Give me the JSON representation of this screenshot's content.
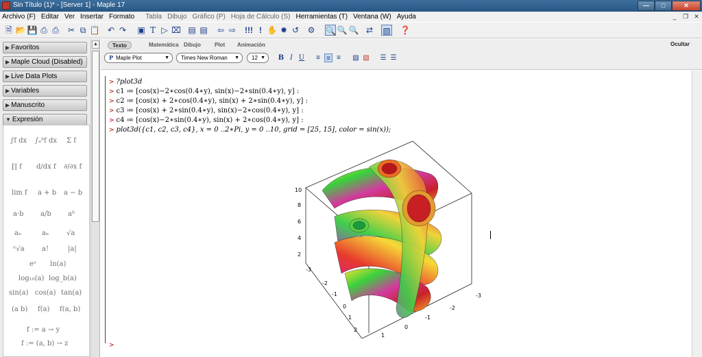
{
  "window": {
    "title": "Sin Título (1)* - [Server 1] - Maple 17",
    "buttons": [
      "minimize",
      "maximize",
      "close"
    ]
  },
  "menu": [
    {
      "label": "Archivo (F)",
      "enabled": true
    },
    {
      "label": "Editar",
      "enabled": true
    },
    {
      "label": "Ver",
      "enabled": true
    },
    {
      "label": "Insertar",
      "enabled": true
    },
    {
      "label": "Formato",
      "enabled": true
    },
    {
      "label": "Tabla",
      "enabled": false
    },
    {
      "label": "Dibujo",
      "enabled": false
    },
    {
      "label": "Gráfico (P)",
      "enabled": false
    },
    {
      "label": "Hoja de Cálculo (S)",
      "enabled": false
    },
    {
      "label": "Herramientas (T)",
      "enabled": true
    },
    {
      "label": "Ventana (W)",
      "enabled": true
    },
    {
      "label": "Ayuda",
      "enabled": true
    }
  ],
  "toolbar_icons": [
    "new-document-icon",
    "open-icon",
    "save-icon",
    "print-icon",
    "print-preview-icon",
    "cut-icon",
    "copy-icon",
    "paste-icon",
    "undo-icon",
    "redo-icon",
    "text-mode-icon",
    "math-text-icon",
    "prompt-icon",
    "section-icon",
    "table-icon",
    "paragraph-icon",
    "back-icon",
    "forward-icon",
    "execute-all-icon",
    "execute-icon",
    "stop-icon",
    "debug-icon",
    "restart-icon",
    "settings-icon",
    "zoom-100-icon",
    "zoom-150-icon",
    "zoom-200-icon",
    "toggle-icon",
    "view-icon",
    "help-icon"
  ],
  "palettes": [
    {
      "label": "Favoritos",
      "expanded": false
    },
    {
      "label": "Maple Cloud (Disabled)",
      "expanded": false
    },
    {
      "label": "Live Data Plots",
      "expanded": false
    },
    {
      "label": "Variables",
      "expanded": false
    },
    {
      "label": "Manuscrito",
      "expanded": false
    },
    {
      "label": "Expresión",
      "expanded": true
    }
  ],
  "expression_palette": [
    [
      "∫f dx",
      "∫ₐᵇf dx",
      "Σ f"
    ],
    [
      "∏ f",
      "d/dx f",
      "∂/∂x f"
    ],
    [
      "lim f",
      "a + b",
      "a − b"
    ],
    [
      "a·b",
      "a/b",
      "aᵇ"
    ],
    [
      "aₙ",
      "aₙ",
      "√a"
    ],
    [
      "ⁿ√a",
      "a!",
      "|a|"
    ],
    [
      "eᵃ",
      "ln(a)"
    ],
    [
      "log₁₀(a)",
      "log_b(a)"
    ],
    [
      "sin(a)",
      "cos(a)",
      "tan(a)"
    ],
    [
      "(a b)",
      "f(a)",
      "f(a, b)"
    ],
    [
      "f := a → y"
    ],
    [
      "f := (a, b) → z"
    ]
  ],
  "context_tabs": [
    {
      "label": "Texto",
      "active": true
    },
    {
      "label": "Matemática",
      "active": false
    },
    {
      "label": "Dibujo",
      "active": false
    },
    {
      "label": "Plot",
      "active": false
    },
    {
      "label": "Animación",
      "active": false
    }
  ],
  "hide_label": "Ocultar",
  "style_dropdown": "Maple Plot",
  "font_dropdown": "Times New Roman",
  "size_dropdown": "12",
  "format_buttons": {
    "bold": "B",
    "italic": "I",
    "underline": "U"
  },
  "worksheet": {
    "prompt": ">",
    "lines": [
      "?plot3d",
      "c1 ≔ [cos(x)−2∗cos(0.4∗y), sin(x)−2∗sin(0.4∗y), y] :",
      "c2 ≔ [cos(x) + 2∗cos(0.4∗y), sin(x) + 2∗sin(0.4∗y), y] :",
      "c3 ≔ [cos(x) + 2∗sin(0.4∗y), sin(x)−2∗cos(0.4∗y), y] :",
      "c4 ≔ [cos(x)−2∗sin(0.4∗y), sin(x) + 2∗cos(0.4∗y), y] :",
      "plot3d({c1, c2, c3, c4}, x = 0 ..2∗Pi, y = 0 ..10, grid = [25, 15], color = sin(x));"
    ]
  },
  "plot": {
    "z_ticks": [
      "10",
      "8",
      "6",
      "4",
      "2"
    ],
    "y_ticks": [
      "-3",
      "-2",
      "-1",
      "0",
      "1",
      "2"
    ],
    "x_ticks": [
      "-3",
      "-2",
      "-1",
      "0",
      "1"
    ],
    "corner_labels": [
      "-3",
      "3"
    ]
  }
}
